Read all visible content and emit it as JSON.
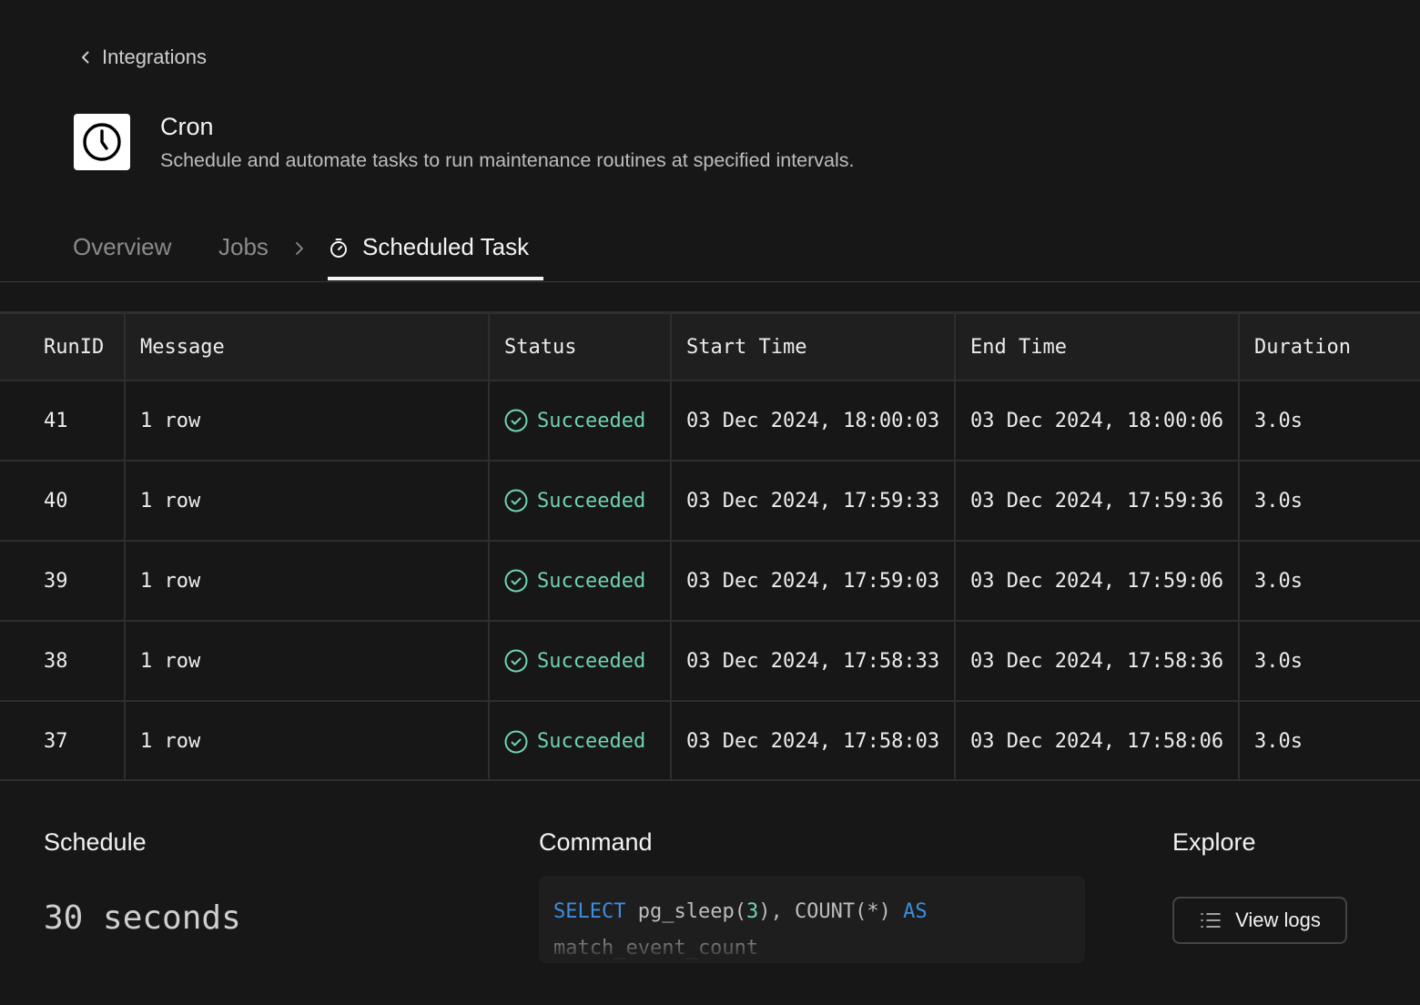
{
  "breadcrumb": {
    "label": "Integrations"
  },
  "header": {
    "title": "Cron",
    "description": "Schedule and automate tasks to run maintenance routines at specified intervals."
  },
  "tabs": {
    "overview": "Overview",
    "jobs": "Jobs",
    "active": "Scheduled Task"
  },
  "table": {
    "columns": [
      "RunID",
      "Message",
      "Status",
      "Start Time",
      "End Time",
      "Duration"
    ],
    "rows": [
      {
        "run_id": "41",
        "message": "1 row",
        "status": "Succeeded",
        "start": "03 Dec 2024, 18:00:03",
        "end": "03 Dec 2024, 18:00:06",
        "duration": "3.0s"
      },
      {
        "run_id": "40",
        "message": "1 row",
        "status": "Succeeded",
        "start": "03 Dec 2024, 17:59:33",
        "end": "03 Dec 2024, 17:59:36",
        "duration": "3.0s"
      },
      {
        "run_id": "39",
        "message": "1 row",
        "status": "Succeeded",
        "start": "03 Dec 2024, 17:59:03",
        "end": "03 Dec 2024, 17:59:06",
        "duration": "3.0s"
      },
      {
        "run_id": "38",
        "message": "1 row",
        "status": "Succeeded",
        "start": "03 Dec 2024, 17:58:33",
        "end": "03 Dec 2024, 17:58:36",
        "duration": "3.0s"
      },
      {
        "run_id": "37",
        "message": "1 row",
        "status": "Succeeded",
        "start": "03 Dec 2024, 17:58:03",
        "end": "03 Dec 2024, 17:58:06",
        "duration": "3.0s"
      }
    ]
  },
  "schedule": {
    "title": "Schedule",
    "value": "30 seconds"
  },
  "command": {
    "title": "Command",
    "kw_select": "SELECT",
    "fn": "pg_sleep(",
    "arg": "3",
    "rest": "), COUNT(*)",
    "kw_as": "AS",
    "alias": "match_event_count"
  },
  "explore": {
    "title": "Explore",
    "button_label": "View logs"
  },
  "colors": {
    "success": "#6fd3b0",
    "keyword": "#3b8fe0",
    "background": "#171717"
  },
  "icons": [
    "chevron-left-icon",
    "clock-icon",
    "chevron-right-icon",
    "stopwatch-icon",
    "check-circle-icon",
    "list-icon"
  ]
}
